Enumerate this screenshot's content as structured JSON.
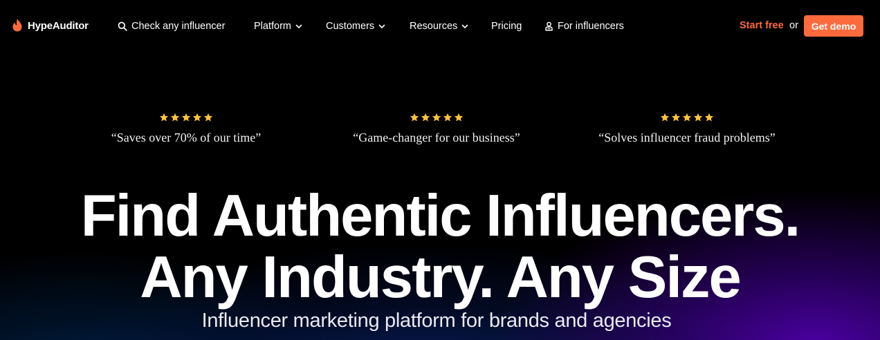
{
  "brand": {
    "name": "HypeAuditor",
    "accent": "#ff6a3d"
  },
  "nav": {
    "search_label": "Check any influencer",
    "items": [
      {
        "label": "Platform",
        "has_dropdown": true
      },
      {
        "label": "Customers",
        "has_dropdown": true
      },
      {
        "label": "Resources",
        "has_dropdown": true
      },
      {
        "label": "Pricing",
        "has_dropdown": false
      }
    ],
    "influencers_label": "For influencers",
    "start_free": "Start free",
    "or": "or",
    "get_demo": "Get demo"
  },
  "hero": {
    "star_color": "#ffc23d",
    "quotes": [
      {
        "text": "“Saves over 70% of our time”",
        "stars": 5
      },
      {
        "text": "“Game-changer for our business”",
        "stars": 5
      },
      {
        "text": "“Solves influencer fraud problems”",
        "stars": 5
      }
    ],
    "headline_line1": "Find Authentic Influencers.",
    "headline_line2": "Any Industry. Any Size",
    "subheadline": "Influencer marketing platform for brands and agencies"
  }
}
